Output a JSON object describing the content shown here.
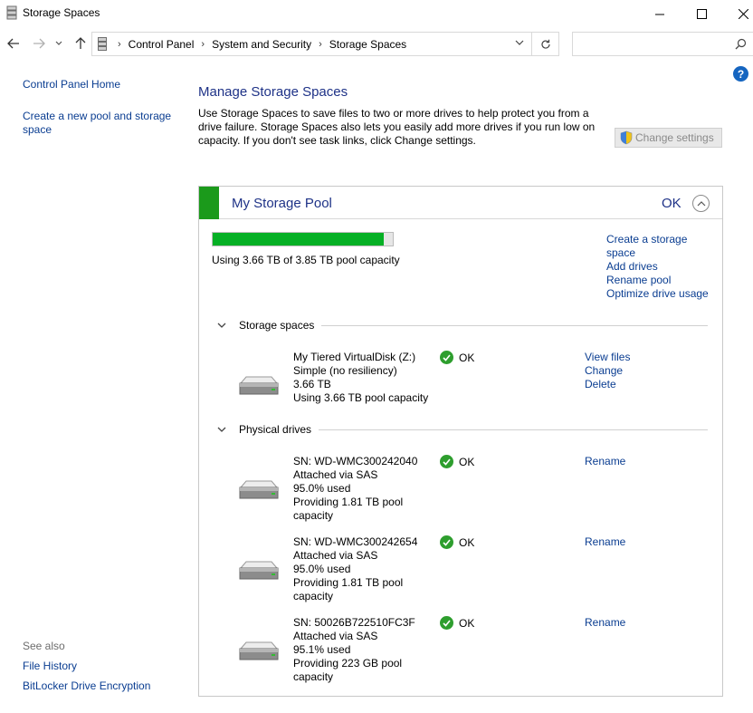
{
  "window": {
    "title": "Storage Spaces"
  },
  "breadcrumb": [
    "Control Panel",
    "System and Security",
    "Storage Spaces"
  ],
  "search": {
    "placeholder": "",
    "value": ""
  },
  "left_pane": {
    "home": "Control Panel Home",
    "create_pool": "Create a new pool and storage space",
    "see_also_heading": "See also",
    "see_also": [
      "File History",
      "BitLocker Drive Encryption"
    ]
  },
  "main": {
    "title": "Manage Storage Spaces",
    "description": "Use Storage Spaces to save files to two or more drives to help protect you from a drive failure. Storage Spaces also lets you easily add more drives if you run low on capacity. If you don't see task links, click Change settings.",
    "change_settings": "Change settings"
  },
  "pool": {
    "name": "My Storage Pool",
    "status": "OK",
    "usage_fraction": 0.9506,
    "usage_text": "Using 3.66 TB of 3.85 TB pool capacity",
    "links": [
      "Create a storage space",
      "Add drives",
      "Rename pool",
      "Optimize drive usage"
    ],
    "storage_spaces_heading": "Storage spaces",
    "physical_drives_heading": "Physical drives",
    "spaces": [
      {
        "name": "My Tiered VirtualDisk (Z:)",
        "resiliency": "Simple (no resiliency)",
        "size": "3.66 TB",
        "usage": "Using 3.66 TB pool capacity",
        "status": "OK",
        "actions": [
          "View files",
          "Change",
          "Delete"
        ]
      }
    ],
    "drives": [
      {
        "sn": "SN: WD-WMC300242040",
        "attach": "Attached via SAS",
        "used": "95.0% used",
        "providing": "Providing 1.81 TB pool capacity",
        "status": "OK",
        "action": "Rename"
      },
      {
        "sn": "SN: WD-WMC300242654",
        "attach": "Attached via SAS",
        "used": "95.0% used",
        "providing": "Providing 1.81 TB pool capacity",
        "status": "OK",
        "action": "Rename"
      },
      {
        "sn": "SN: 50026B722510FC3F",
        "attach": "Attached via SAS",
        "used": "95.1% used",
        "providing": "Providing 223 GB pool capacity",
        "status": "OK",
        "action": "Rename"
      }
    ]
  },
  "colors": {
    "accent": "#1b9a1b",
    "link": "#0a3d91",
    "heading": "#1e3287",
    "bar_fill": "#06b025"
  },
  "icons": [
    "storage-spaces-icon",
    "back-arrow-icon",
    "forward-arrow-icon",
    "recent-chevron-icon",
    "up-arrow-icon",
    "refresh-icon",
    "search-icon",
    "help-icon",
    "shield-icon",
    "chevron-up-icon",
    "chevron-down-icon",
    "drive-icon",
    "ok-check-icon"
  ]
}
